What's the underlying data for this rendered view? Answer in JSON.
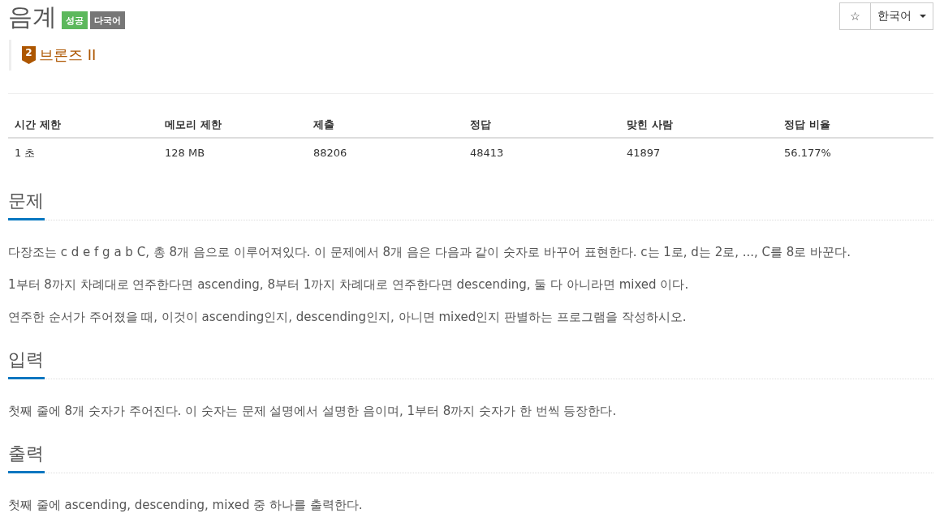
{
  "title": "음계",
  "badges": [
    {
      "label": "성공",
      "kind": "success"
    },
    {
      "label": "다국어",
      "kind": "multilang"
    }
  ],
  "toolbar": {
    "star": "☆",
    "language": "한국어"
  },
  "tier": {
    "level": "2",
    "name": "브론즈 II"
  },
  "stats": {
    "columns": [
      "시간 제한",
      "메모리 제한",
      "제출",
      "정답",
      "맞힌 사람",
      "정답 비율"
    ],
    "rows": [
      [
        "1 초",
        "128 MB",
        "88206",
        "48413",
        "41897",
        "56.177%"
      ]
    ]
  },
  "sections": [
    {
      "heading": "문제",
      "paragraphs": [
        "다장조는 c d e f g a b C, 총 8개 음으로 이루어져있다. 이 문제에서 8개 음은 다음과 같이 숫자로 바꾸어 표현한다. c는 1로, d는 2로, ..., C를 8로 바꾼다.",
        "1부터 8까지 차례대로 연주한다면 ascending, 8부터 1까지 차례대로 연주한다면 descending, 둘 다 아니라면 mixed 이다.",
        "연주한 순서가 주어졌을 때, 이것이 ascending인지, descending인지, 아니면 mixed인지 판별하는 프로그램을 작성하시오."
      ]
    },
    {
      "heading": "입력",
      "paragraphs": [
        "첫째 줄에 8개 숫자가 주어진다. 이 숫자는 문제 설명에서 설명한 음이며, 1부터 8까지 숫자가 한 번씩 등장한다."
      ]
    },
    {
      "heading": "출력",
      "paragraphs": [
        "첫째 줄에 ascending, descending, mixed 중 하나를 출력한다."
      ]
    }
  ]
}
